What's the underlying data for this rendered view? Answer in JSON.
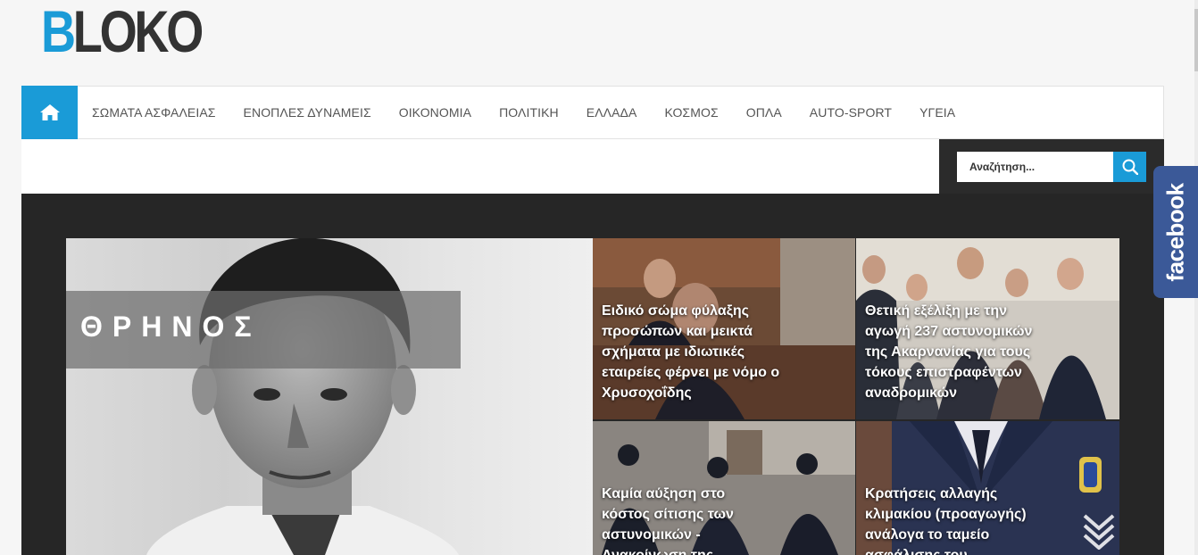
{
  "logo": {
    "first_letter": "B",
    "rest": "LOKO"
  },
  "colors": {
    "accent": "#1a9bd7",
    "facebook": "#3b5998",
    "dark_bg": "#262626"
  },
  "nav": {
    "home_icon": "home-icon",
    "items": [
      "ΣΩΜΑΤΑ ΑΣΦΑΛΕΙΑΣ",
      "ΕΝΟΠΛΕΣ ΔΥΝΑΜΕΙΣ",
      "ΟΙΚΟΝΟΜΙΑ",
      "ΠΟΛΙΤΙΚΗ",
      "ΕΛΛΑΔΑ",
      "ΚΟΣΜΟΣ",
      "ΟΠΛΑ",
      "AUTO-SPORT",
      "ΥΓΕΙΑ"
    ]
  },
  "search": {
    "placeholder": "Αναζήτηση...",
    "icon": "search-icon"
  },
  "hero": {
    "tag": "ΘΡΗΝΟΣ"
  },
  "cards": [
    {
      "title": "Ειδικό σώμα φύλαξης προσώπων και μεικτά σχήματα με ιδιωτικές εταιρείες φέρνει με νόμο ο Χρυσοχοΐδης"
    },
    {
      "title": "Θετική εξέλιξη με την αγωγή 237 αστυνομικών της Ακαρνανίας για τους τόκους επιστραφέντων αναδρομικών"
    },
    {
      "title": "Καμία αύξηση στο κόστος σίτισης των αστυνομικών - Ανακοίνωση της"
    },
    {
      "title": "Κρατήσεις αλλαγής κλιμακίου (προαγωγής) ανάλογα το ταμείο ασφάλισης του"
    }
  ],
  "social": {
    "facebook_label": "facebook"
  }
}
